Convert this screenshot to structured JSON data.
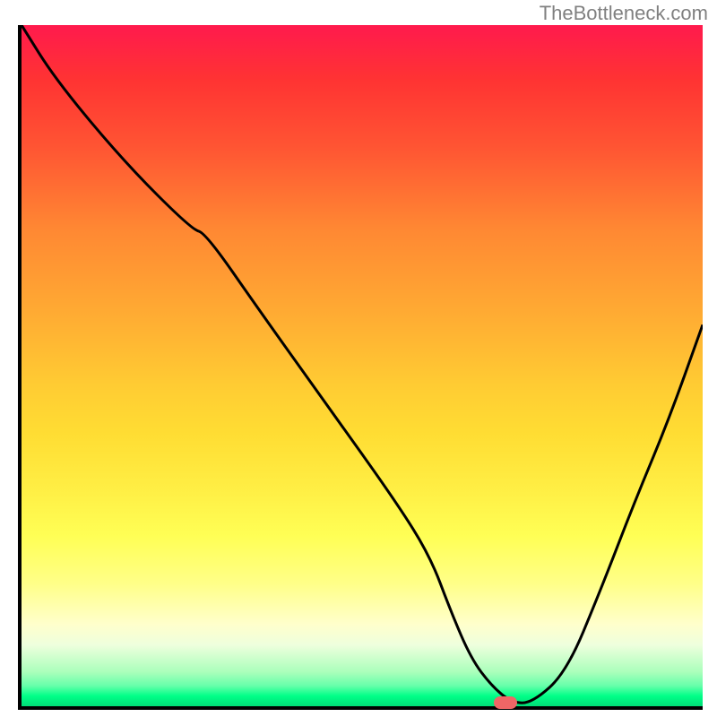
{
  "watermark": "TheBottleneck.com",
  "chart_data": {
    "type": "line",
    "title": "",
    "xlabel": "",
    "ylabel": "",
    "xlim": [
      0,
      100
    ],
    "ylim": [
      0,
      100
    ],
    "x": [
      0,
      5,
      15,
      25,
      27,
      35,
      45,
      55,
      60,
      63,
      66,
      69,
      72,
      75,
      80,
      85,
      90,
      95,
      100
    ],
    "values": [
      100,
      92,
      80,
      70,
      69.5,
      58,
      44,
      30,
      22,
      14,
      7,
      3,
      0.5,
      0.5,
      5,
      17,
      30,
      42,
      56
    ],
    "marker": {
      "x": 71,
      "y": 0.5
    },
    "background": "rainbow-gradient-vertical"
  }
}
